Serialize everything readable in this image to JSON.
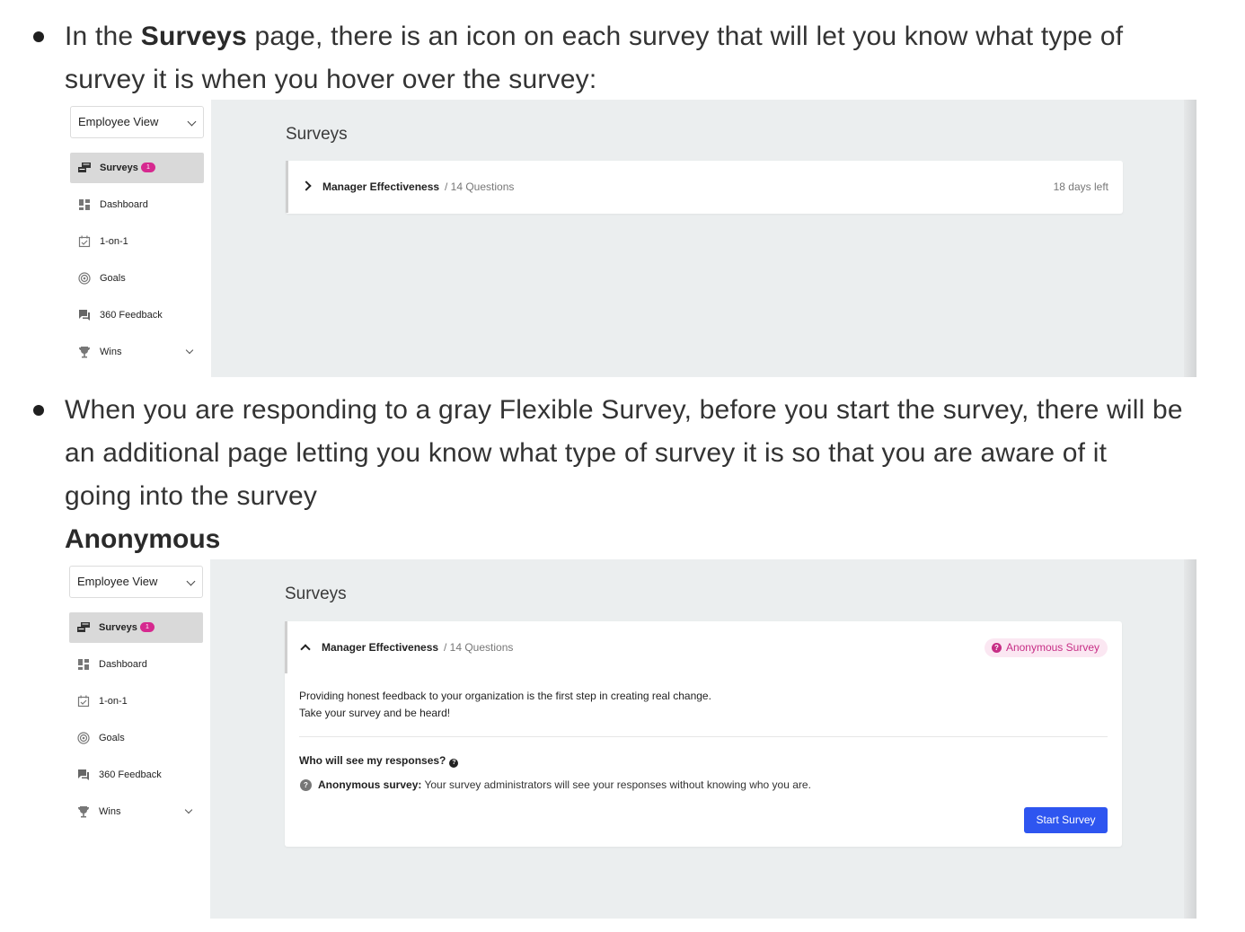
{
  "paragraph1": {
    "prefix": "In the ",
    "bold": "Surveys",
    "suffix_line1": " page, there is an icon on each survey that will let you know what type of",
    "line2": "survey it is when you hover over the survey:"
  },
  "paragraph2": {
    "line1": "When you are responding to a gray Flexible Survey, before you start the survey, there will be",
    "line2": "an additional page letting you know what type of survey it is so that you are aware of it",
    "line3": "going into the survey"
  },
  "heading_anonymous": "Anonymous",
  "shot1": {
    "view_select": "Employee View",
    "nav": [
      {
        "label": "Surveys",
        "icon": "surveys-icon",
        "active": true,
        "badge": "1"
      },
      {
        "label": "Dashboard",
        "icon": "dashboard-icon"
      },
      {
        "label": "1-on-1",
        "icon": "calendar-check-icon"
      },
      {
        "label": "Goals",
        "icon": "target-icon"
      },
      {
        "label": "360 Feedback",
        "icon": "chat-icon"
      },
      {
        "label": "Wins",
        "icon": "trophy-icon"
      }
    ],
    "title": "Surveys",
    "survey_name": "Manager Effectiveness",
    "question_count": "/ 14 Questions",
    "days_left": "18 days left"
  },
  "shot2": {
    "view_select": "Employee View",
    "nav": [
      {
        "label": "Surveys",
        "icon": "surveys-icon",
        "active": true,
        "badge": "1"
      },
      {
        "label": "Dashboard",
        "icon": "dashboard-icon"
      },
      {
        "label": "1-on-1",
        "icon": "calendar-check-icon"
      },
      {
        "label": "Goals",
        "icon": "target-icon"
      },
      {
        "label": "360 Feedback",
        "icon": "chat-icon"
      },
      {
        "label": "Wins",
        "icon": "trophy-icon"
      }
    ],
    "title": "Surveys",
    "survey_name": "Manager Effectiveness",
    "question_count": "/ 14 Questions",
    "anon_pill": "Anonymous Survey",
    "intro_line1": "Providing honest feedback to your organization is the first step in creating real change.",
    "intro_line2": "Take your survey and be heard!",
    "who_heading": "Who will see my responses?",
    "anon_label": "Anonymous survey:",
    "anon_text": " Your survey administrators will see your responses without knowing who you are.",
    "start_button": "Start Survey"
  },
  "colors": {
    "badge": "#d6298f",
    "primary_button": "#2e55f0",
    "anon_pill_bg": "#fbe7f2",
    "anon_pill_text": "#c72e86",
    "content_bg": "#ebeeef"
  }
}
